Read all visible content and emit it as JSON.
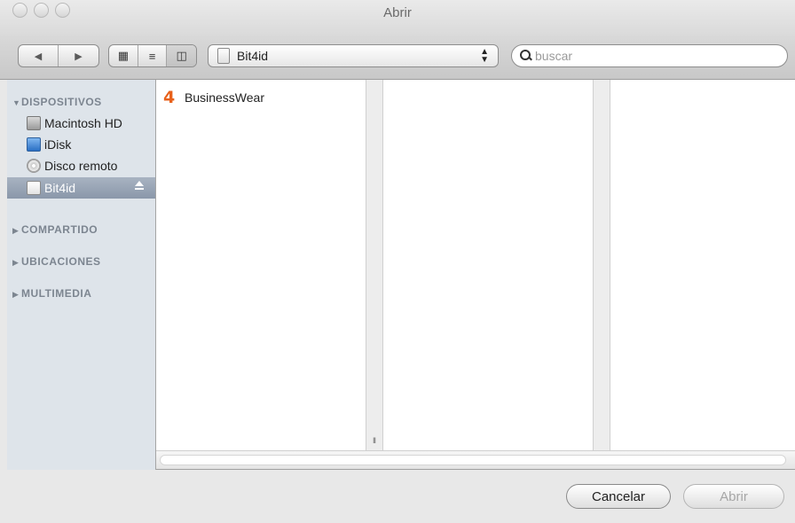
{
  "window": {
    "title": "Abrir"
  },
  "toolbar": {
    "nav": {
      "back_glyph": "◀",
      "forward_glyph": "▶"
    },
    "view_modes": [
      {
        "name": "icon-view",
        "glyph": "▦"
      },
      {
        "name": "list-view",
        "glyph": "≡"
      },
      {
        "name": "column-view",
        "glyph": "◫",
        "selected": true
      }
    ],
    "location_popup": {
      "label": "Bit4id",
      "arrows": "▲▼"
    },
    "search": {
      "placeholder": "buscar",
      "value": ""
    }
  },
  "sidebar": {
    "sections": [
      {
        "label": "DISPOSITIVOS",
        "expanded": true,
        "triangle": "▼"
      },
      {
        "label": "COMPARTIDO",
        "expanded": false,
        "triangle": "▶"
      },
      {
        "label": "UBICACIONES",
        "expanded": false,
        "triangle": "▶"
      },
      {
        "label": "MULTIMEDIA",
        "expanded": false,
        "triangle": "▶"
      }
    ],
    "devices": [
      {
        "label": "Macintosh HD",
        "icon": "hard-drive-icon"
      },
      {
        "label": "iDisk",
        "icon": "idisk-icon"
      },
      {
        "label": "Disco remoto",
        "icon": "disc-icon"
      },
      {
        "label": "Bit4id",
        "icon": "drive-icon",
        "selected": true,
        "ejectable": true
      }
    ]
  },
  "browser": {
    "column1": [
      {
        "label": "BusinessWear",
        "icon": "app-4-icon",
        "icon_text": "4",
        "icon_color": "#e8611b"
      }
    ],
    "resize_handle": "II"
  },
  "buttons": {
    "cancel": "Cancelar",
    "open": "Abrir",
    "open_enabled": false
  }
}
